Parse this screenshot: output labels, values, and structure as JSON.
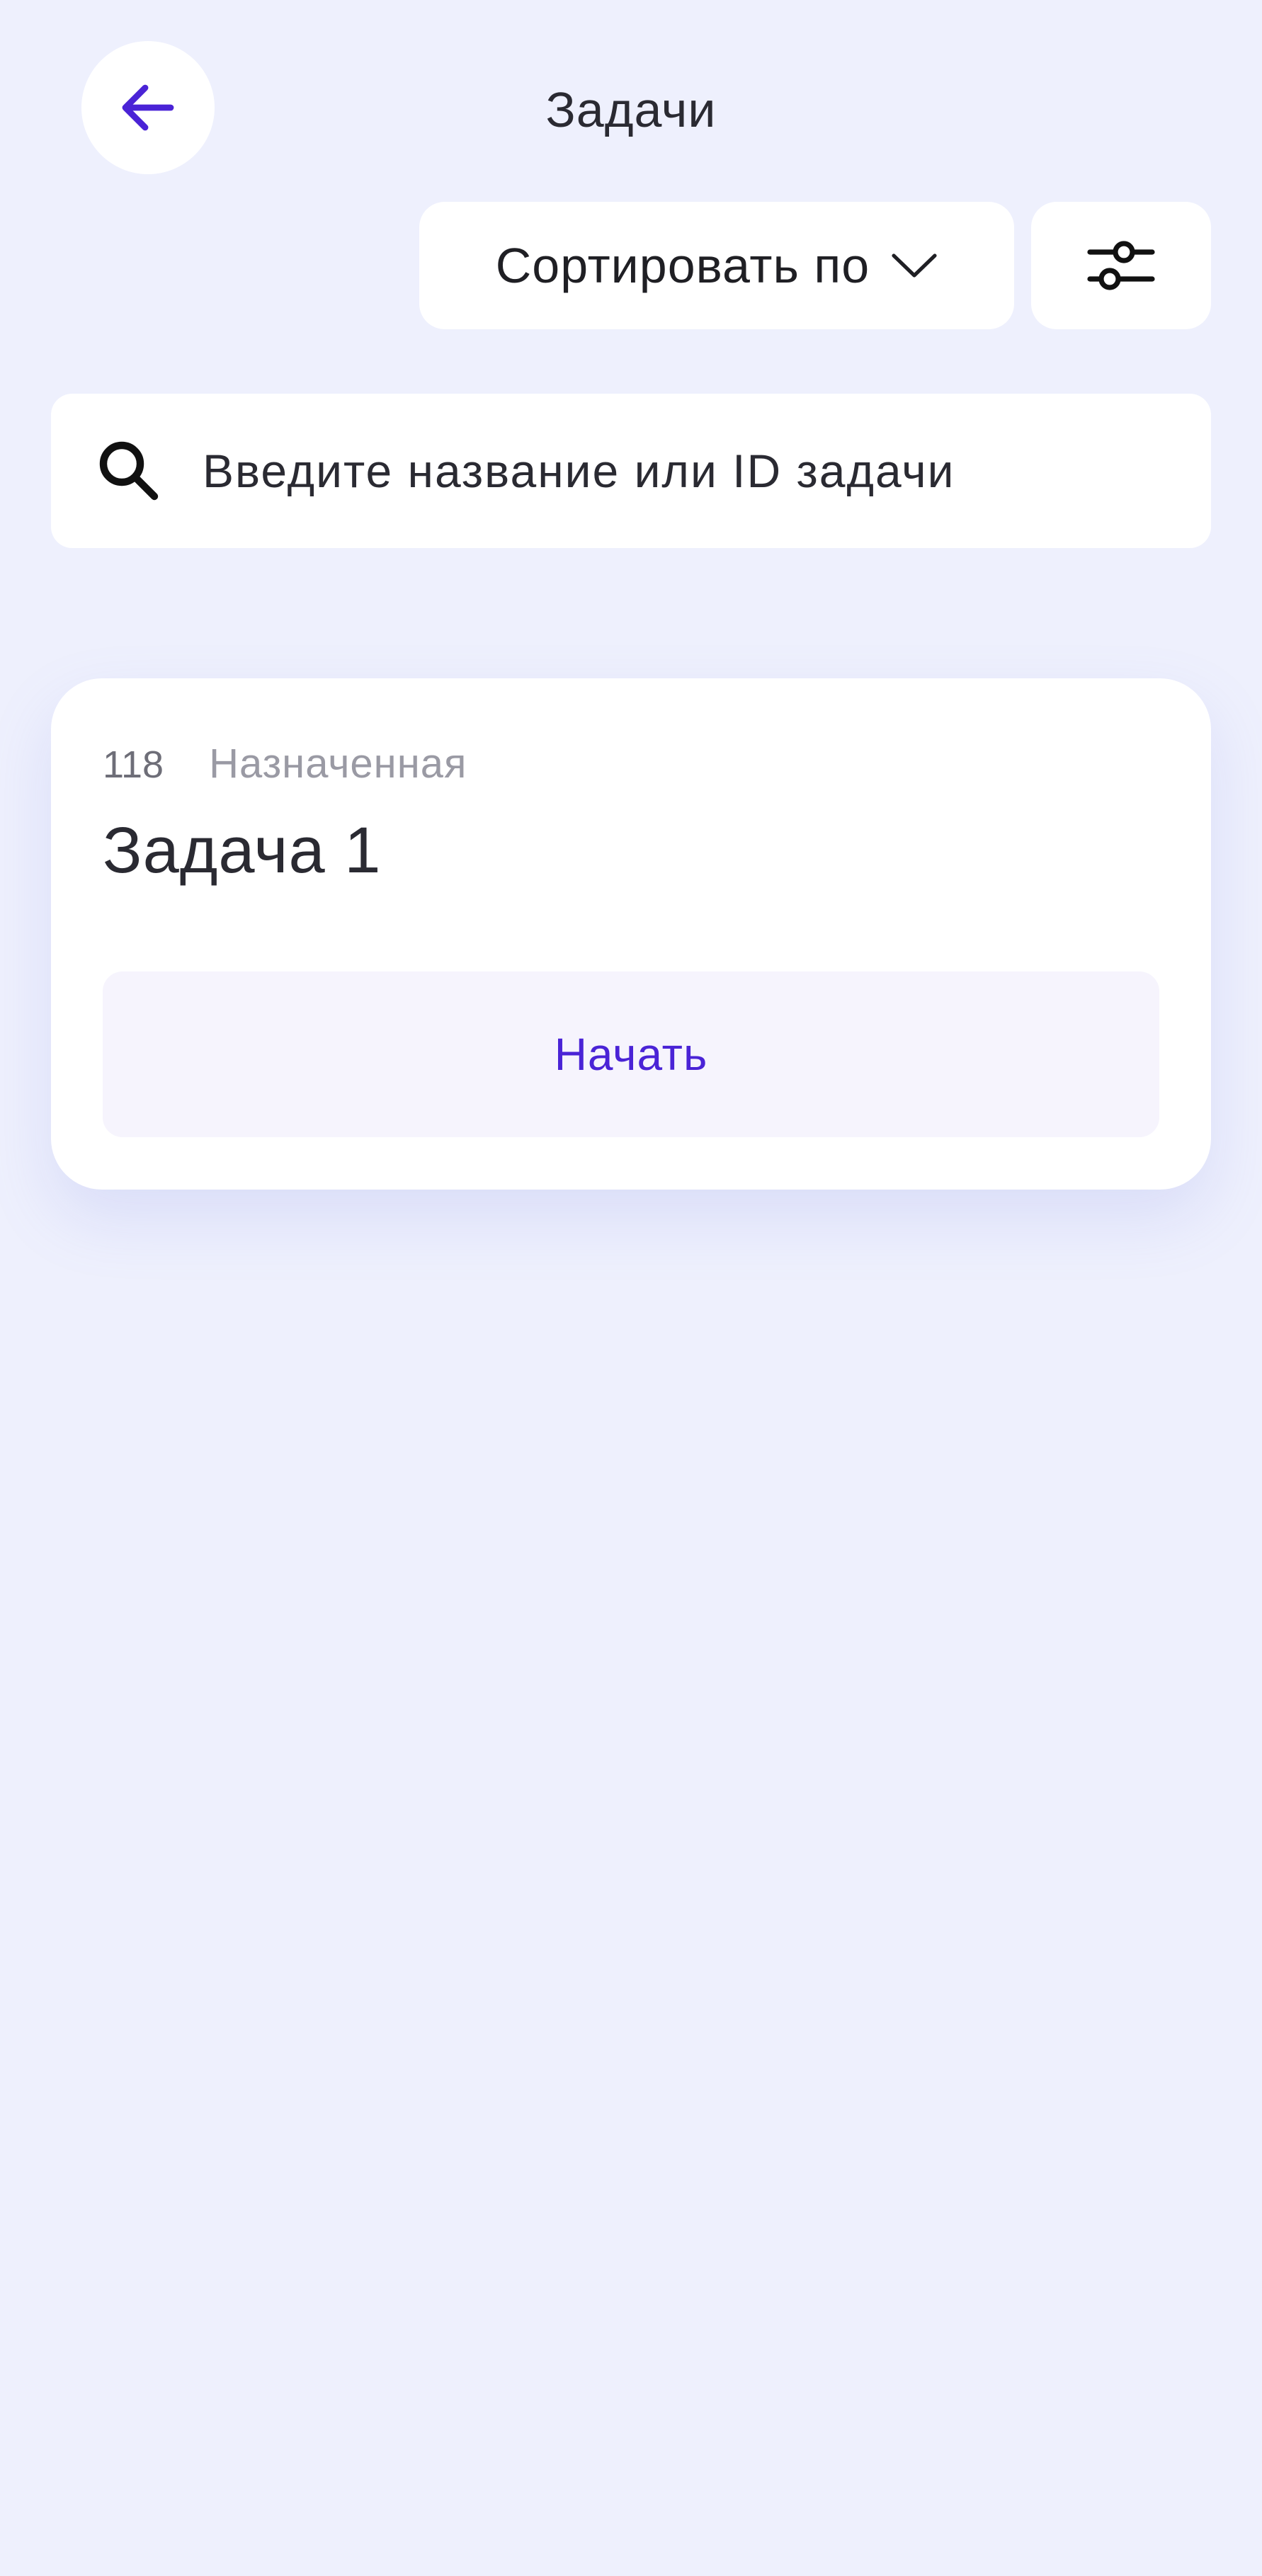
{
  "header": {
    "title": "Задачи",
    "back_icon": "arrow-left-icon"
  },
  "toolbar": {
    "sort_label": "Сортировать по",
    "sort_icon": "chevron-down-icon",
    "filter_icon": "sliders-icon"
  },
  "search": {
    "placeholder": "Введите название или ID задачи",
    "value": "",
    "icon": "search-icon"
  },
  "tasks": [
    {
      "id": "118",
      "status": "Назначенная",
      "title": "Задача 1",
      "action_label": "Начать"
    }
  ],
  "colors": {
    "background": "#EEF0FD",
    "accent": "#4A23D6",
    "surface": "#FFFFFF",
    "button_surface": "#F6F4FD",
    "text_primary": "#2A2A32",
    "text_muted": "#9A9AA4"
  }
}
